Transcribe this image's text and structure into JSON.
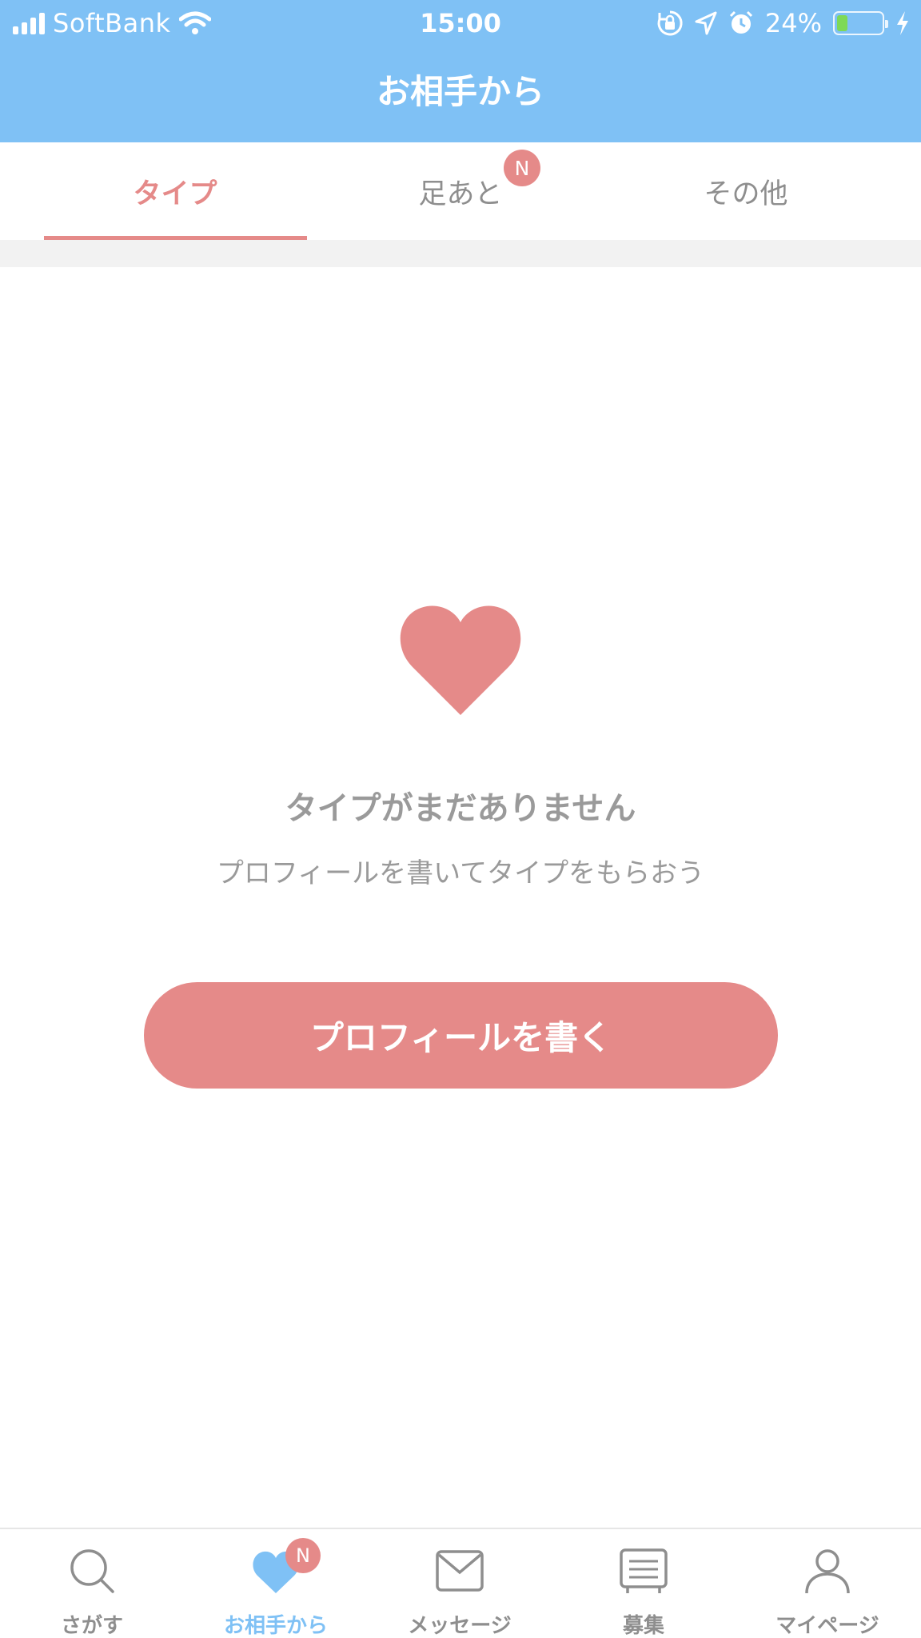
{
  "status_bar": {
    "carrier": "SoftBank",
    "time": "15:00",
    "battery_percent": "24%",
    "battery_level": 0.24,
    "icons": [
      "signal-icon",
      "wifi-icon",
      "rotation-lock-icon",
      "location-icon",
      "alarm-icon",
      "battery-icon",
      "charging-icon"
    ]
  },
  "header": {
    "title": "お相手から"
  },
  "tabs": {
    "items": [
      {
        "label": "タイプ",
        "active": true
      },
      {
        "label": "足あと",
        "badge": "N"
      },
      {
        "label": "その他"
      }
    ]
  },
  "empty_state": {
    "icon": "heart-icon",
    "title": "タイプがまだありません",
    "subtitle": "プロフィールを書いてタイプをもらおう",
    "button_label": "プロフィールを書く"
  },
  "tabbar": {
    "items": [
      {
        "label": "さがす",
        "icon": "search-icon"
      },
      {
        "label": "お相手から",
        "icon": "heart-icon",
        "active": true,
        "badge": "N"
      },
      {
        "label": "メッセージ",
        "icon": "envelope-icon"
      },
      {
        "label": "募集",
        "icon": "board-icon"
      },
      {
        "label": "マイページ",
        "icon": "person-icon"
      }
    ]
  },
  "colors": {
    "header_bg": "#7fc1f5",
    "accent_pink": "#e58a89",
    "text_gray": "#8e8e8e",
    "active_blue": "#7fc1f5",
    "battery_green": "#7ed957"
  }
}
